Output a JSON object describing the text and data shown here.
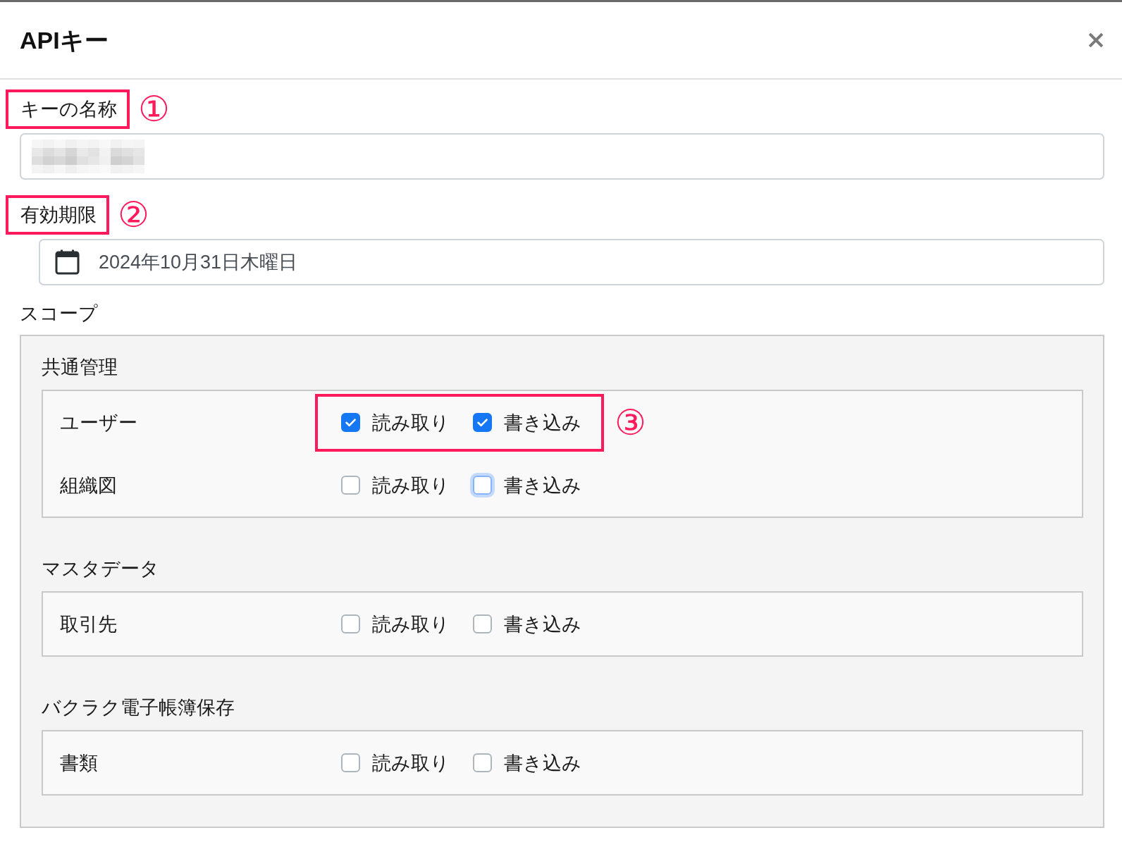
{
  "dialog": {
    "title": "APIキー"
  },
  "fields": [
    {
      "kind": "text",
      "label": "キーの名称",
      "callout": "①",
      "redacted": true
    },
    {
      "kind": "date",
      "label": "有効期限",
      "callout": "②",
      "value": "2024年10月31日木曜日"
    }
  ],
  "scope": {
    "label": "スコープ",
    "groups": [
      {
        "title": "共通管理",
        "rows": [
          {
            "name": "ユーザー",
            "callout": "③",
            "permissions": [
              {
                "label": "読み取り",
                "checked": true,
                "focused": false
              },
              {
                "label": "書き込み",
                "checked": true,
                "focused": false
              }
            ]
          },
          {
            "name": "組織図",
            "permissions": [
              {
                "label": "読み取り",
                "checked": false,
                "focused": false
              },
              {
                "label": "書き込み",
                "checked": false,
                "focused": true
              }
            ]
          }
        ]
      },
      {
        "title": "マスタデータ",
        "rows": [
          {
            "name": "取引先",
            "permissions": [
              {
                "label": "読み取り",
                "checked": false,
                "focused": false
              },
              {
                "label": "書き込み",
                "checked": false,
                "focused": false
              }
            ]
          }
        ]
      },
      {
        "title": "バクラク電子帳簿保存",
        "rows": [
          {
            "name": "書類",
            "permissions": [
              {
                "label": "読み取り",
                "checked": false,
                "focused": false
              },
              {
                "label": "書き込み",
                "checked": false,
                "focused": false
              }
            ]
          }
        ]
      }
    ]
  }
}
